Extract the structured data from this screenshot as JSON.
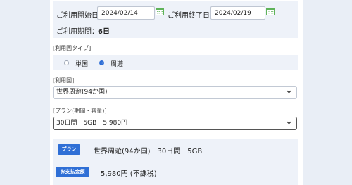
{
  "dates": {
    "start_label": "ご利用開始日：",
    "start_value": "2024/02/14",
    "end_label": "ご利用終了日：",
    "end_value": "2024/02/19",
    "period_label": "ご利用期間：",
    "period_value": "6日",
    "calendar_icon": "calendar-icon"
  },
  "country_type": {
    "label": "[利用国タイプ]",
    "options": [
      "単国",
      "周遊"
    ],
    "selected": "周遊"
  },
  "country": {
    "label": "[利用国]",
    "value": "世界周遊(94か国)"
  },
  "plan": {
    "label": "[プラン(期間・容量)]",
    "value": "30日間　5GB　5,980円"
  },
  "summary": {
    "plan_badge": "プラン",
    "plan_text": "世界周遊(94か国)　30日間　5GB",
    "amount_badge": "お支払金額",
    "amount_text": "5,980円 (不課税)"
  },
  "colors": {
    "accent": "#2f6fd6",
    "calendar_icon": "#5fb35a",
    "background": "#e9eef6",
    "section_bg": "#eef2f9"
  }
}
